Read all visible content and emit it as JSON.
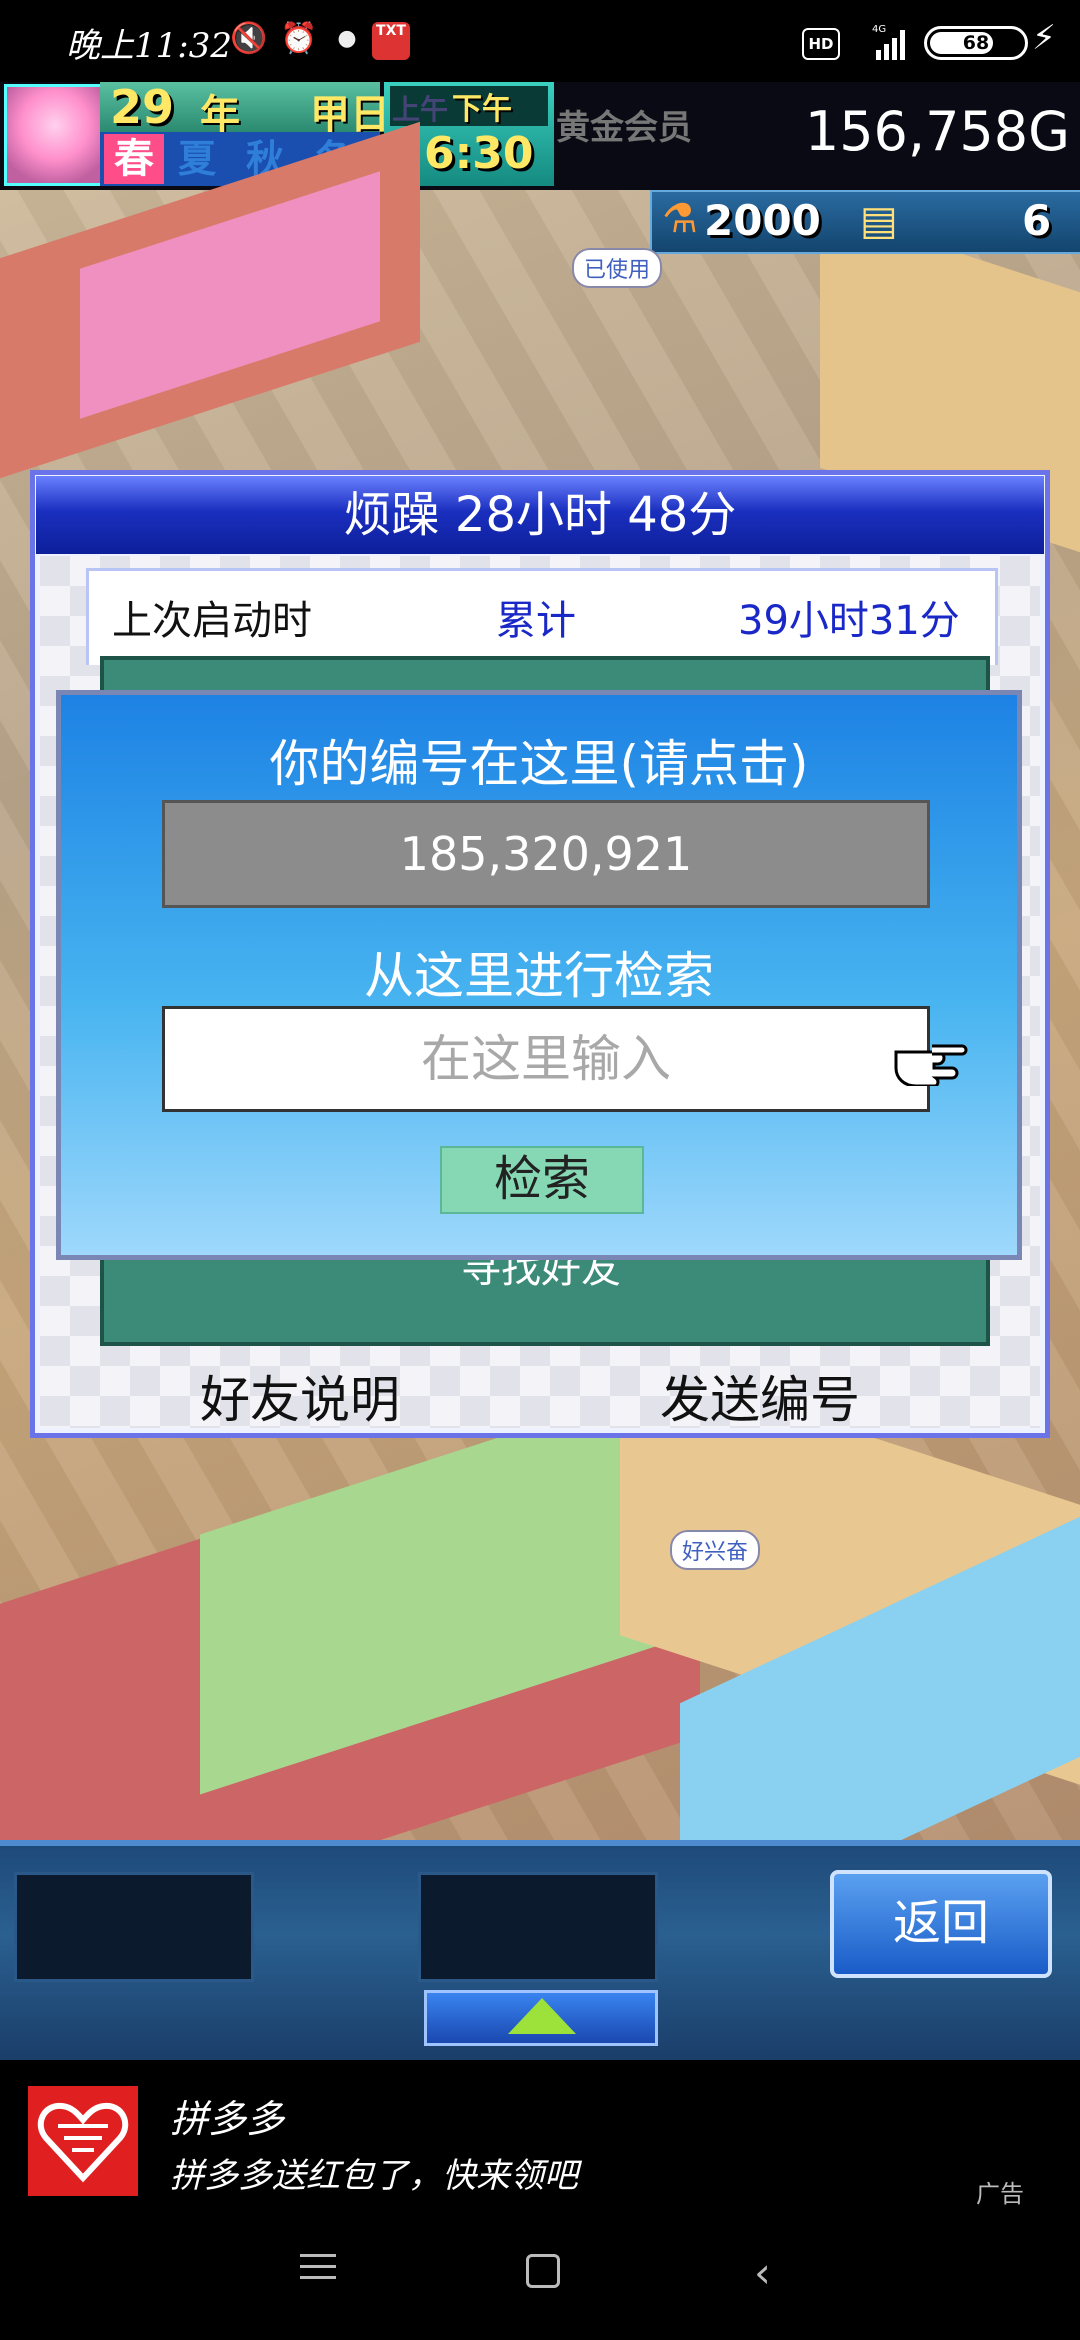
{
  "status_bar": {
    "time": "晚上11:32",
    "icons": [
      "mute-icon",
      "alarm-icon",
      "cookie-icon",
      "txt-app-icon"
    ],
    "txt_badge": "TXT",
    "hd": "HD",
    "network": "4G",
    "battery": "68",
    "battery_level": 0.68
  },
  "hud": {
    "year": "29",
    "year_label": "年",
    "day_label": "甲日",
    "season_current": "春",
    "seasons_other": [
      "夏",
      "秋",
      "冬"
    ],
    "am": "上午",
    "pm": "下午",
    "clock": "6:30",
    "member": "黄金会员",
    "gold": "156,758G",
    "research_points": "2000",
    "tickets": "6",
    "used_bubble": "已使用",
    "happy_bubble": "好兴奋"
  },
  "outer_dialog": {
    "title": "烦躁  28小时 48分",
    "last_launch_label": "上次启动时",
    "total_label": "累计",
    "total_value": "39小时31分",
    "find_friend": "寻找好友",
    "friend_help": "好友说明",
    "send_id": "发送编号"
  },
  "search_dialog": {
    "your_id_label": "你的编号在这里(请点击)",
    "your_id": "185,320,921",
    "search_label": "从这里进行检索",
    "search_placeholder": "在这里输入",
    "search_button": "检索"
  },
  "bottom_bar": {
    "back_button": "返回"
  },
  "ad": {
    "app_name": "拼多多",
    "description": "拼多多送红包了，快来领吧",
    "tag": "广告"
  },
  "colors": {
    "title_bar": "#1a2fbf",
    "dialog_blue": "#1d82e4",
    "search_button": "#86d8b4",
    "find_friend_panel": "#3c8a78",
    "gold_text": "#ffffff"
  }
}
